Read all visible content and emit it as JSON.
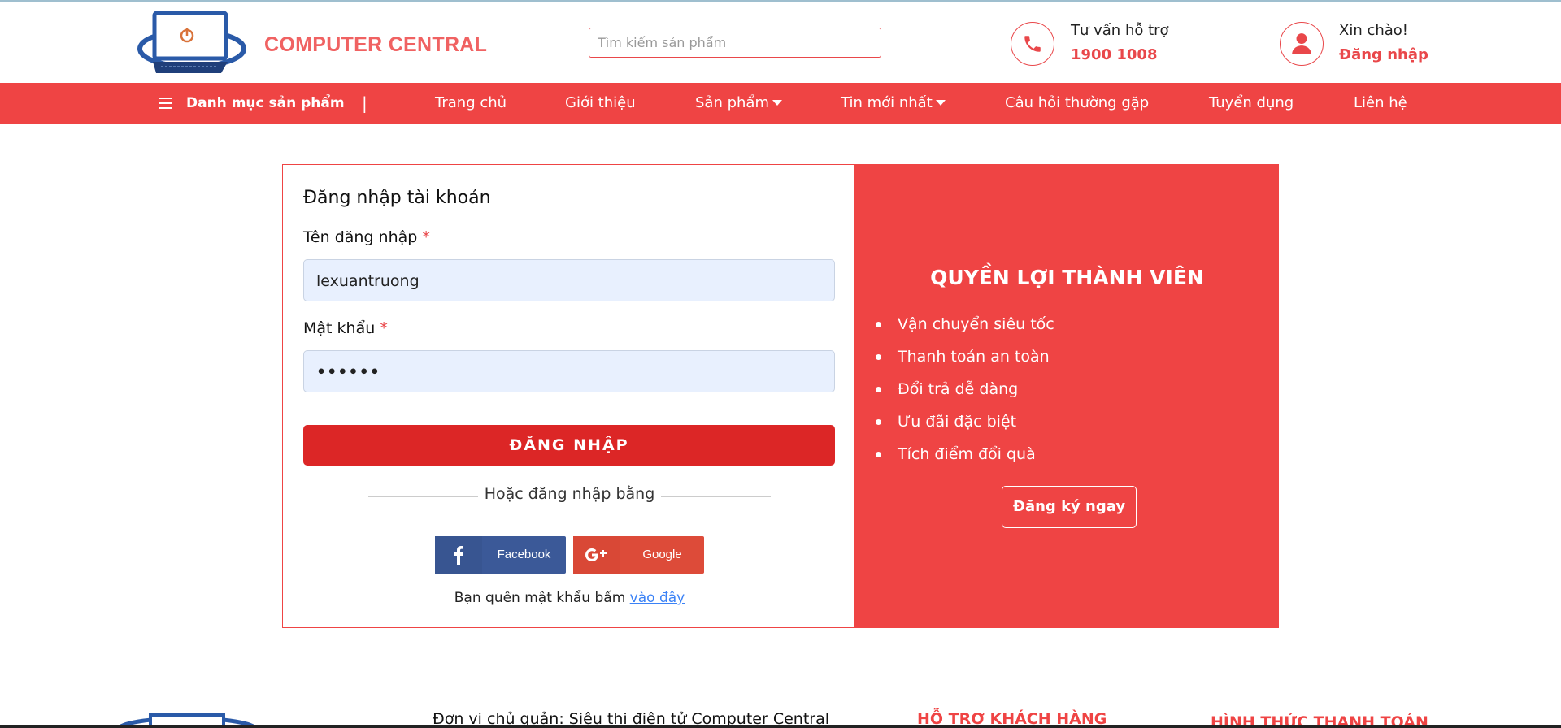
{
  "header": {
    "brand": "COMPUTER CENTRAL",
    "search_placeholder": "Tìm kiếm sản phẩm",
    "support_label": "Tư vấn hỗ trợ",
    "support_phone": "1900 1008",
    "greeting": "Xin chào!",
    "login_link": "Đăng nhập"
  },
  "nav": {
    "category": "Danh mục sản phẩm",
    "separator": "|",
    "items": [
      "Trang chủ",
      "Giới thiệu",
      "Sản phẩm",
      "Tin mới nhất",
      "Câu hỏi thường gặp",
      "Tuyển dụng",
      "Liên hệ"
    ]
  },
  "login": {
    "title": "Đăng nhập tài khoản",
    "username_label": "Tên đăng nhập",
    "username_value": "lexuantruong",
    "password_label": "Mật khẩu",
    "password_value": "••••••",
    "required_mark": "*",
    "submit": "ĐĂNG NHẬP",
    "or_text": "Hoặc đăng nhập bằng",
    "facebook": "Facebook",
    "google": "Google",
    "forgot_text": "Bạn quên mật khẩu bấm",
    "forgot_link": "vào đây"
  },
  "benefits": {
    "title": "QUYỀN LỢI THÀNH VIÊN",
    "items": [
      "Vận chuyển siêu tốc",
      "Thanh toán an toàn",
      "Đổi trả dễ dàng",
      "Ưu đãi đặc biệt",
      "Tích điểm đổi quà"
    ],
    "register": "Đăng ký ngay"
  },
  "footer": {
    "owner": "Đơn vị chủ quản: Siêu thị điện tử Computer Central",
    "support_head": "HỖ TRỢ KHÁCH HÀNG",
    "payment_head": "HÌNH THỨC THANH TOÁN"
  },
  "colors": {
    "accent": "#ef4444",
    "button": "#dc2626",
    "facebook": "#3b5998",
    "google": "#dd4b39",
    "brand_text": "#f06262"
  }
}
